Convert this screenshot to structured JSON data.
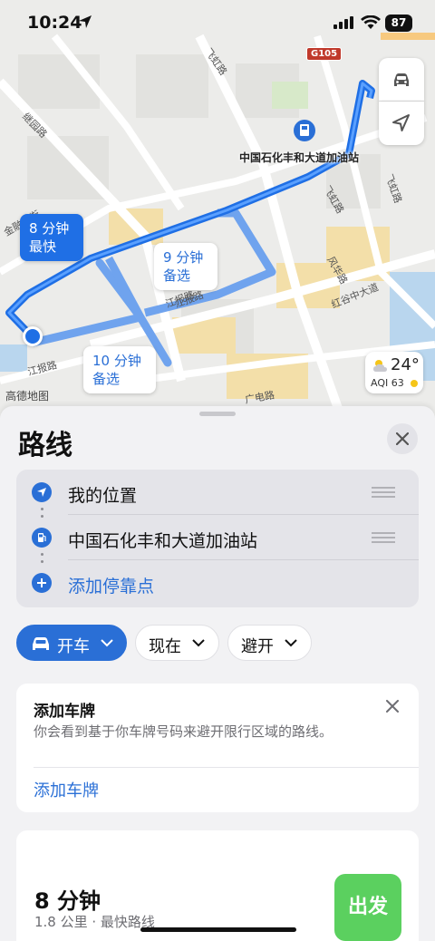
{
  "status_bar": {
    "time": "10:24",
    "battery": "87"
  },
  "map": {
    "road_labels": [
      "飞虹路",
      "继园路",
      "金融大街",
      "江报路",
      "红谷中大道",
      "飞虹路",
      "风华路",
      "江报路",
      "广电路",
      "飞虹路",
      "江报路"
    ],
    "highway_badge": "G105",
    "poi_label": "中国石化丰和大道加油站",
    "callouts": {
      "fastest_time": "8 分钟",
      "fastest_tag": "最快",
      "alt1_time": "9 分钟",
      "alt1_tag": "备选",
      "alt2_time": "10 分钟",
      "alt2_tag": "备选"
    },
    "weather": {
      "temp": "24°",
      "aqi": "AQI 63"
    },
    "attribution": "高德地图"
  },
  "sheet": {
    "title": "路线",
    "stops": [
      {
        "label": "我的位置",
        "icon": "location-arrow-icon"
      },
      {
        "label": "中国石化丰和大道加油站",
        "icon": "fuel-pump-icon"
      },
      {
        "label": "添加停靠点",
        "icon": "plus-icon"
      }
    ],
    "options": {
      "mode": "开车",
      "time": "现在",
      "avoid": "避开"
    },
    "plate_card": {
      "title": "添加车牌",
      "description": "你会看到基于你车牌号码来避开限行区域的路线。",
      "link": "添加车牌"
    },
    "route": {
      "time": "8 分钟",
      "detail": "1.8 公里 · 最快路线",
      "go_label": "出发"
    }
  },
  "colors": {
    "accent": "#2a6fd6",
    "route": "#1f6fe5",
    "go": "#5bd05f"
  }
}
